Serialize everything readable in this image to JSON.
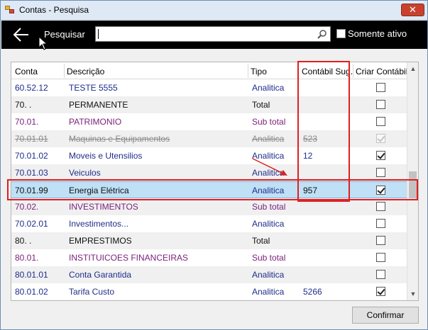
{
  "window": {
    "title": "Contas - Pesquisa",
    "close_label": "✕"
  },
  "toolbar": {
    "search_label": "Pesquisar",
    "search_value": "",
    "somente_ativo_label": "Somente ativo",
    "somente_ativo_checked": false
  },
  "grid": {
    "columns": [
      "Conta",
      "Descrição",
      "Tipo",
      "Contábil Sug.",
      "Criar Contábil"
    ],
    "rows": [
      {
        "conta": "60.52.12",
        "descricao": "TESTE 5555",
        "tipo": "Analitica",
        "contabil": "",
        "criar": false,
        "style": "blue"
      },
      {
        "conta": "70.  .",
        "descricao": "PERMANENTE",
        "tipo": "Total",
        "contabil": "",
        "criar": false,
        "style": "black"
      },
      {
        "conta": "70.01.",
        "descricao": "PATRIMONIO",
        "tipo": "Sub total",
        "contabil": "",
        "criar": false,
        "style": "purple"
      },
      {
        "conta": "70.01.01",
        "descricao": "Maquinas e Equipamentos",
        "tipo": "Analitica",
        "contabil": "523",
        "criar": true,
        "style": "disabled"
      },
      {
        "conta": "70.01.02",
        "descricao": "Moveis e Utensilios",
        "tipo": "Analitica",
        "contabil": "12",
        "criar": true,
        "style": "blue"
      },
      {
        "conta": "70.01.03",
        "descricao": "Veiculos",
        "tipo": "Analitica",
        "contabil": "",
        "criar": false,
        "style": "blue"
      },
      {
        "conta": "70.01.99",
        "descricao": "Energia Elétrica",
        "tipo": "Analitica",
        "contabil": "957",
        "criar": true,
        "style": "selected"
      },
      {
        "conta": "70.02.",
        "descricao": "INVESTIMENTOS",
        "tipo": "Sub total",
        "contabil": "",
        "criar": false,
        "style": "purple"
      },
      {
        "conta": "70.02.01",
        "descricao": "Investimentos...",
        "tipo": "Analitica",
        "contabil": "",
        "criar": false,
        "style": "blue"
      },
      {
        "conta": "80.  .",
        "descricao": "EMPRESTIMOS",
        "tipo": "Total",
        "contabil": "",
        "criar": false,
        "style": "black"
      },
      {
        "conta": "80.01.",
        "descricao": "INSTITUICOES FINANCEIRAS",
        "tipo": "Sub total",
        "contabil": "",
        "criar": false,
        "style": "purple"
      },
      {
        "conta": "80.01.01",
        "descricao": "Conta Garantida",
        "tipo": "Analitica",
        "contabil": "",
        "criar": false,
        "style": "blue"
      },
      {
        "conta": "80.01.02",
        "descricao": "Tarifa Custo",
        "tipo": "Analitica",
        "contabil": "5266",
        "criar": true,
        "style": "blue"
      }
    ]
  },
  "footer": {
    "confirm_label": "Confirmar"
  },
  "colors": {
    "blue_text": "#1f2d8a",
    "purple_text": "#7a1f7a",
    "selected_row": "#bfe0f5",
    "annotation_red": "#e02020"
  },
  "icons": [
    "back-arrow-icon",
    "search-icon",
    "checkbox-icon",
    "close-icon",
    "app-icon"
  ]
}
